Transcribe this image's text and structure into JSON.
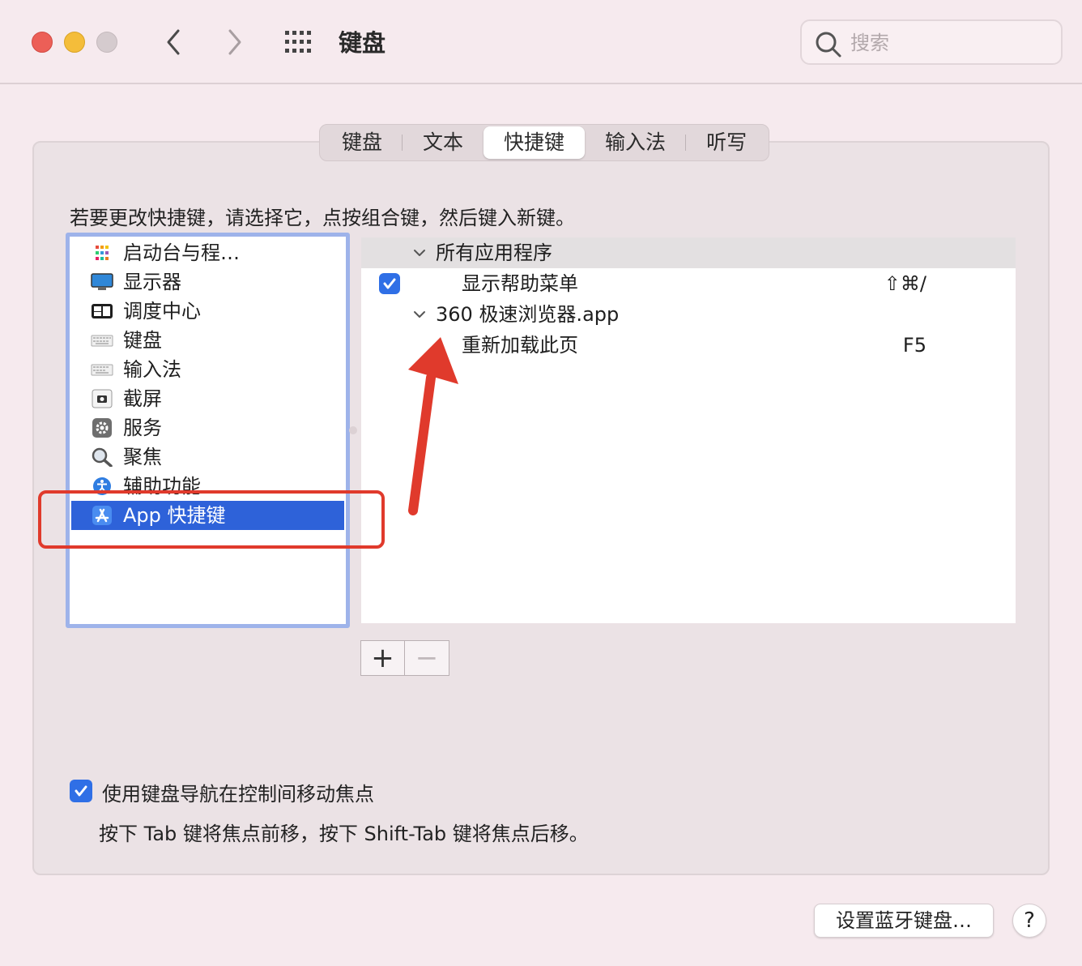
{
  "window": {
    "title": "键盘",
    "search_placeholder": "搜索"
  },
  "tabs": [
    {
      "label": "键盘"
    },
    {
      "label": "文本"
    },
    {
      "label": "快捷键",
      "active": true
    },
    {
      "label": "输入法"
    },
    {
      "label": "听写"
    }
  ],
  "instruction": "若要更改快捷键，请选择它，点按组合键，然后键入新键。",
  "categories": [
    {
      "label": "启动台与程…",
      "icon": "launchpad-icon"
    },
    {
      "label": "显示器",
      "icon": "display-icon"
    },
    {
      "label": "调度中心",
      "icon": "mission-control-icon"
    },
    {
      "label": "键盘",
      "icon": "keyboard-icon"
    },
    {
      "label": "输入法",
      "icon": "input-method-icon"
    },
    {
      "label": "截屏",
      "icon": "screenshot-icon"
    },
    {
      "label": "服务",
      "icon": "gear-icon"
    },
    {
      "label": "聚焦",
      "icon": "magnifier-icon"
    },
    {
      "label": "辅助功能",
      "icon": "accessibility-icon"
    },
    {
      "label": "App 快捷键",
      "icon": "app-store-icon",
      "selected": true
    }
  ],
  "shortcuts": {
    "groups": [
      {
        "name": "所有应用程序",
        "items": [
          {
            "label": "显示帮助菜单",
            "keys": "⇧⌘/",
            "checked": true
          }
        ]
      },
      {
        "name": "360 极速浏览器.app",
        "items": [
          {
            "label": "重新加载此页",
            "keys": "F5"
          }
        ]
      }
    ]
  },
  "buttons": {
    "add": "+",
    "remove": "−",
    "bluetooth": "设置蓝牙键盘…",
    "help": "?"
  },
  "keyboard_nav": {
    "label": "使用键盘导航在控制间移动焦点",
    "description": "按下 Tab 键将焦点前移，按下 Shift-Tab 键将焦点后移。",
    "checked": true
  },
  "colors": {
    "accent": "#2e62d9",
    "annotation": "#e03a2c"
  }
}
